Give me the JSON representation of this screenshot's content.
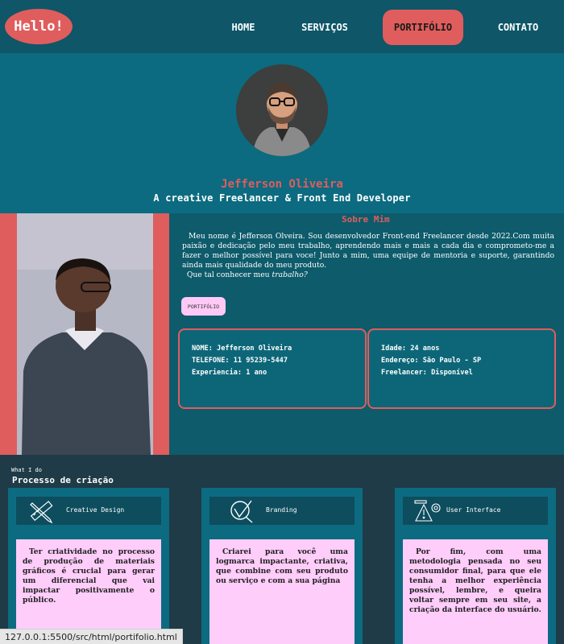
{
  "nav": {
    "logo": "Hello!",
    "items": [
      {
        "label": "HOME"
      },
      {
        "label": "SERVIÇOS"
      },
      {
        "label": "PORTIFÓLIO"
      },
      {
        "label": "CONTATO"
      }
    ]
  },
  "hero": {
    "name": "Jefferson Oliveira",
    "subtitle": "A creative Freelancer & Front End Developer"
  },
  "about": {
    "title": "Sobre Mim",
    "paragraph": "Meu nome é Jefferson Olveira. Sou desenvolvedor Front-end Freelancer desde 2022.Com muita paixão e dedicação pelo meu trabalho, aprendendo mais e mais a cada dia e comprometo-me a fazer o melhor possível para voce! Junto a mim, uma equipe de mentoria e suporte, garantindo ainda mais qualidade do meu produto.",
    "question_prefix": "Que tal conhecer meu ",
    "question_italic": "trabalho?",
    "button_label": "PORTIFÓLIO",
    "info_left": [
      "NOME: Jefferson Oliveira",
      "TELEFONE: 11 95239-5447",
      "Experiencia: 1 ano"
    ],
    "info_right": [
      "Idade: 24 anos",
      "Endereço: São Paulo - SP",
      "Freelancer: Disponível"
    ]
  },
  "process": {
    "label": "What I do",
    "title": "Processo de criação",
    "cards": [
      {
        "title": "Creative Design",
        "icon": "ruler-pencil-icon",
        "text": "Ter criatividade no processo de produção de materiais gráficos é crucial para gerar um diferencial que vai impactar positivamente o público."
      },
      {
        "title": "Branding",
        "icon": "checkmark-brand-icon",
        "text": "Criarei para você uma logmarca impactante, criativa, que combine com seu produto ou serviço e com a sua página"
      },
      {
        "title": "User Interface",
        "icon": "ui-settings-icon",
        "text": "Por fim, com uma metodologia pensada no seu consumidor final, para que ele tenha a melhor experiência possível, lembre, e queira voltar sempre em seu site, a criação da interface do usuário."
      }
    ]
  },
  "status_bar": "127.0.0.1:5500/src/html/portifolio.html",
  "colors": {
    "accent": "#e05d5d",
    "nav_bg": "#0e5668",
    "hero_bg": "#0c6b80",
    "card_body": "#ffcdfa",
    "process_bg": "#1f3b47"
  }
}
